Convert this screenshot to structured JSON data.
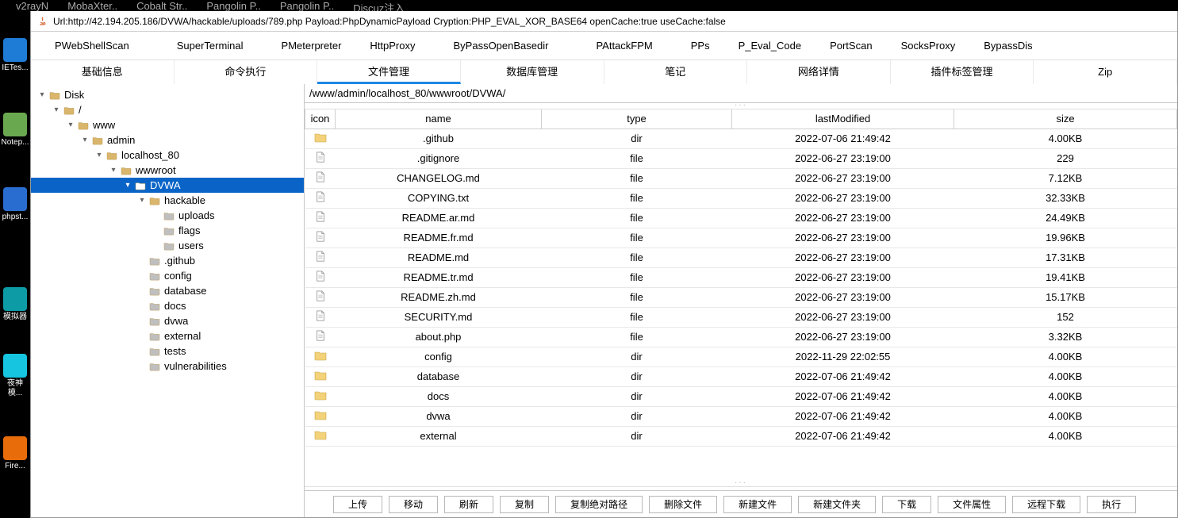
{
  "top_tabs": [
    "v2rayN",
    "MobaXter..",
    "Cobalt Str..",
    "Pangolin P..",
    "Pangolin P..",
    "Discuz注入"
  ],
  "desktop": [
    {
      "label": "IETes...",
      "bg": "#1e7bd6"
    },
    {
      "label": "Notep...",
      "bg": "#6aa84f"
    },
    {
      "label": "phpst...",
      "bg": "#2a6dd0"
    },
    {
      "label": "模拟器",
      "bg": "#0d9ba6"
    },
    {
      "label": "夜神模...",
      "bg": "#16c5e0"
    },
    {
      "label": "Fire...",
      "bg": "#e86c0a"
    }
  ],
  "title": "Url:http://42.194.205.186/DVWA/hackable/uploads/789.php Payload:PhpDynamicPayload Cryption:PHP_EVAL_XOR_BASE64 openCache:true useCache:false",
  "toolbar": [
    "PWebShellScan",
    "SuperTerminal",
    "PMeterpreter",
    "HttpProxy",
    "ByPassOpenBasedir",
    "PAttackFPM",
    "PPs",
    "P_Eval_Code",
    "PortScan",
    "SocksProxy",
    "BypassDis"
  ],
  "navtabs": {
    "items": [
      "基础信息",
      "命令执行",
      "文件管理",
      "数据库管理",
      "笔记",
      "网络详情",
      "插件标签管理",
      "Zip"
    ],
    "active": 2
  },
  "tree": [
    {
      "depth": 0,
      "exp": "open",
      "label": "Disk",
      "sel": false,
      "kind": "folder"
    },
    {
      "depth": 1,
      "exp": "open",
      "label": "/",
      "sel": false,
      "kind": "folder"
    },
    {
      "depth": 2,
      "exp": "open",
      "label": "www",
      "sel": false,
      "kind": "folder"
    },
    {
      "depth": 3,
      "exp": "open",
      "label": "admin",
      "sel": false,
      "kind": "folder"
    },
    {
      "depth": 4,
      "exp": "open",
      "label": "localhost_80",
      "sel": false,
      "kind": "folder"
    },
    {
      "depth": 5,
      "exp": "open",
      "label": "wwwroot",
      "sel": false,
      "kind": "folder"
    },
    {
      "depth": 6,
      "exp": "open",
      "label": "DVWA",
      "sel": true,
      "kind": "folder"
    },
    {
      "depth": 7,
      "exp": "open",
      "label": "hackable",
      "sel": false,
      "kind": "folder"
    },
    {
      "depth": 8,
      "exp": "leaf",
      "label": "uploads",
      "sel": false,
      "kind": "folder"
    },
    {
      "depth": 8,
      "exp": "leaf",
      "label": "flags",
      "sel": false,
      "kind": "folder"
    },
    {
      "depth": 8,
      "exp": "leaf",
      "label": "users",
      "sel": false,
      "kind": "folder"
    },
    {
      "depth": 7,
      "exp": "leaf",
      "label": ".github",
      "sel": false,
      "kind": "folder"
    },
    {
      "depth": 7,
      "exp": "leaf",
      "label": "config",
      "sel": false,
      "kind": "folder"
    },
    {
      "depth": 7,
      "exp": "leaf",
      "label": "database",
      "sel": false,
      "kind": "folder"
    },
    {
      "depth": 7,
      "exp": "leaf",
      "label": "docs",
      "sel": false,
      "kind": "folder"
    },
    {
      "depth": 7,
      "exp": "leaf",
      "label": "dvwa",
      "sel": false,
      "kind": "folder"
    },
    {
      "depth": 7,
      "exp": "leaf",
      "label": "external",
      "sel": false,
      "kind": "folder"
    },
    {
      "depth": 7,
      "exp": "leaf",
      "label": "tests",
      "sel": false,
      "kind": "folder"
    },
    {
      "depth": 7,
      "exp": "leaf",
      "label": "vulnerabilities",
      "sel": false,
      "kind": "folder"
    }
  ],
  "path": "/www/admin/localhost_80/wwwroot/DVWA/",
  "table": {
    "headers": {
      "icon": "icon",
      "name": "name",
      "type": "type",
      "lastModified": "lastModified",
      "size": "size"
    },
    "rows": [
      {
        "icon": "dir",
        "name": ".github",
        "type": "dir",
        "lm": "2022-07-06 21:49:42",
        "size": "4.00KB"
      },
      {
        "icon": "file",
        "name": ".gitignore",
        "type": "file",
        "lm": "2022-06-27 23:19:00",
        "size": "229"
      },
      {
        "icon": "file",
        "name": "CHANGELOG.md",
        "type": "file",
        "lm": "2022-06-27 23:19:00",
        "size": "7.12KB"
      },
      {
        "icon": "file",
        "name": "COPYING.txt",
        "type": "file",
        "lm": "2022-06-27 23:19:00",
        "size": "32.33KB"
      },
      {
        "icon": "file",
        "name": "README.ar.md",
        "type": "file",
        "lm": "2022-06-27 23:19:00",
        "size": "24.49KB"
      },
      {
        "icon": "file",
        "name": "README.fr.md",
        "type": "file",
        "lm": "2022-06-27 23:19:00",
        "size": "19.96KB"
      },
      {
        "icon": "file",
        "name": "README.md",
        "type": "file",
        "lm": "2022-06-27 23:19:00",
        "size": "17.31KB"
      },
      {
        "icon": "file",
        "name": "README.tr.md",
        "type": "file",
        "lm": "2022-06-27 23:19:00",
        "size": "19.41KB"
      },
      {
        "icon": "file",
        "name": "README.zh.md",
        "type": "file",
        "lm": "2022-06-27 23:19:00",
        "size": "15.17KB"
      },
      {
        "icon": "file",
        "name": "SECURITY.md",
        "type": "file",
        "lm": "2022-06-27 23:19:00",
        "size": "152"
      },
      {
        "icon": "file",
        "name": "about.php",
        "type": "file",
        "lm": "2022-06-27 23:19:00",
        "size": "3.32KB"
      },
      {
        "icon": "dir",
        "name": "config",
        "type": "dir",
        "lm": "2022-11-29 22:02:55",
        "size": "4.00KB"
      },
      {
        "icon": "dir",
        "name": "database",
        "type": "dir",
        "lm": "2022-07-06 21:49:42",
        "size": "4.00KB"
      },
      {
        "icon": "dir",
        "name": "docs",
        "type": "dir",
        "lm": "2022-07-06 21:49:42",
        "size": "4.00KB"
      },
      {
        "icon": "dir",
        "name": "dvwa",
        "type": "dir",
        "lm": "2022-07-06 21:49:42",
        "size": "4.00KB"
      },
      {
        "icon": "dir",
        "name": "external",
        "type": "dir",
        "lm": "2022-07-06 21:49:42",
        "size": "4.00KB"
      }
    ]
  },
  "buttons": [
    "上传",
    "移动",
    "刷新",
    "复制",
    "复制绝对路径",
    "删除文件",
    "新建文件",
    "新建文件夹",
    "下载",
    "文件属性",
    "远程下载",
    "执行"
  ]
}
